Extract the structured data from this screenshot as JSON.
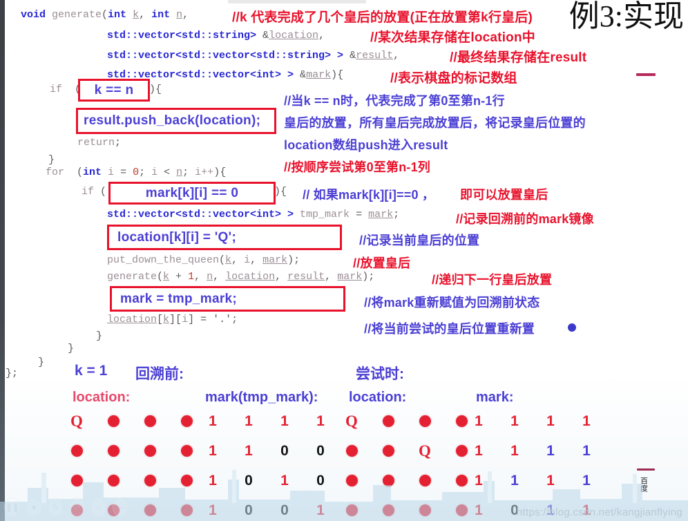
{
  "slide": {
    "title": "例3:实现",
    "watermark": "https://blog.csdn.net/kangjianflying",
    "side_note": "百度"
  },
  "code": {
    "lines": [
      {
        "id": "signature",
        "text": "void generate(int k, int n,"
      },
      {
        "id": "param-location",
        "text": "std::vector<std::string> &location,"
      },
      {
        "id": "param-result",
        "text": "std::vector<std::vector<std::string> > &result,"
      },
      {
        "id": "param-mark",
        "text": "std::vector<std::vector<int> > &mark){"
      },
      {
        "id": "if-open",
        "text": "if (        ){"
      },
      {
        "id": "return",
        "text": "return;"
      },
      {
        "id": "close-if",
        "text": "}"
      },
      {
        "id": "for-loop",
        "text": "for (int i = 0; i < n; i++){"
      },
      {
        "id": "if-mark",
        "text": "if (                    ){"
      },
      {
        "id": "tmp-mark",
        "text": "std::vector<std::vector<int> > tmp_mark = mark;"
      },
      {
        "id": "put-queen",
        "text": "put_down_the_queen(k, i, mark);"
      },
      {
        "id": "recurse",
        "text": "generate(k + 1, n, location, result, mark);"
      },
      {
        "id": "reset-location",
        "text": "location[k][i] = '.';"
      },
      {
        "id": "close-if2",
        "text": "}"
      },
      {
        "id": "close-for",
        "text": "}"
      },
      {
        "id": "close-fn",
        "text": "}"
      },
      {
        "id": "close-decl",
        "text": "};"
      }
    ],
    "highlight_boxes": [
      {
        "id": "box-k-eq-n",
        "text": "k == n"
      },
      {
        "id": "box-push-back",
        "text": "result.push_back(location);"
      },
      {
        "id": "box-mark-zero",
        "text": "mark[k][i] == 0"
      },
      {
        "id": "box-location-q",
        "text": "location[k][i] = 'Q';"
      },
      {
        "id": "box-mark-restore",
        "text": "mark = tmp_mark;"
      }
    ]
  },
  "annotations": [
    {
      "id": "ann-k-meaning",
      "text": "//k 代表完成了几个皇后的放置(正在放置第k行皇后)"
    },
    {
      "id": "ann-location",
      "text": "//某次结果存储在location中"
    },
    {
      "id": "ann-result",
      "text": "//最终结果存储在result"
    },
    {
      "id": "ann-mark",
      "text": "//表示棋盘的标记数组"
    },
    {
      "id": "ann-when-k-n",
      "text": "//当k == n时，代表完成了第0至第n-1行"
    },
    {
      "id": "ann-queen-place",
      "text": "皇后的放置，所有皇后完成放置后，将记录皇后位置的"
    },
    {
      "id": "ann-push-result",
      "text": "location数组push进入result"
    },
    {
      "id": "ann-try-cols",
      "text": "//按顺序尝试第0至第n-1列"
    },
    {
      "id": "ann-if-mark0-a",
      "text": "// 如果mark[k][i]==0 ，"
    },
    {
      "id": "ann-if-mark0-b",
      "text": "即可以放置皇后"
    },
    {
      "id": "ann-tmp-mark",
      "text": "//记录回溯前的mark镜像"
    },
    {
      "id": "ann-record-pos",
      "text": "//记录当前皇后的位置"
    },
    {
      "id": "ann-put-queen",
      "text": "//放置皇后"
    },
    {
      "id": "ann-recurse",
      "text": "//递归下一行皇后放置"
    },
    {
      "id": "ann-restore",
      "text": "//将mark重新赋值为回溯前状态"
    },
    {
      "id": "ann-reset",
      "text": "//将当前尝试的皇后位置重新置"
    }
  ],
  "diagram": {
    "k_label": "k = 1",
    "before_label": "回溯前:",
    "trying_label": "尝试时:",
    "panels": [
      {
        "id": "before-location",
        "label": "location:",
        "label_color": "red",
        "type": "board",
        "cells": [
          [
            "Q",
            ".",
            ".",
            "."
          ],
          [
            ".",
            ".",
            ".",
            "."
          ],
          [
            ".",
            ".",
            ".",
            "."
          ],
          [
            ".",
            ".",
            ".",
            "."
          ]
        ]
      },
      {
        "id": "before-mark",
        "label": "mark(tmp_mark):",
        "label_color": "purple",
        "type": "numbers",
        "values": [
          [
            "1",
            "1",
            "1",
            "1"
          ],
          [
            "1",
            "1",
            "0",
            "0"
          ],
          [
            "1",
            "0",
            "1",
            "0"
          ],
          [
            "1",
            "0",
            "0",
            "1"
          ]
        ],
        "colors": [
          [
            "red",
            "red",
            "red",
            "red"
          ],
          [
            "red",
            "red",
            "black",
            "black"
          ],
          [
            "red",
            "black",
            "red",
            "black"
          ],
          [
            "red",
            "black",
            "black",
            "red"
          ]
        ]
      },
      {
        "id": "trying-location",
        "label": "location:",
        "label_color": "purple",
        "type": "board",
        "cells": [
          [
            "Q",
            ".",
            ".",
            "."
          ],
          [
            ".",
            ".",
            "Q",
            "."
          ],
          [
            ".",
            ".",
            ".",
            "."
          ],
          [
            ".",
            ".",
            ".",
            "."
          ]
        ]
      },
      {
        "id": "trying-mark",
        "label": "mark:",
        "label_color": "purple",
        "type": "numbers",
        "values": [
          [
            "1",
            "1",
            "1",
            "1"
          ],
          [
            "1",
            "1",
            "1",
            "1"
          ],
          [
            "1",
            "1",
            "1",
            "1"
          ],
          [
            "1",
            "0",
            "1",
            "1"
          ]
        ],
        "colors": [
          [
            "red",
            "red",
            "red",
            "red"
          ],
          [
            "red",
            "red",
            "blue",
            "blue"
          ],
          [
            "red",
            "blue",
            "red",
            "blue"
          ],
          [
            "red",
            "black",
            "blue",
            "red"
          ]
        ]
      }
    ]
  },
  "player": {
    "buttons": [
      "pause-icon",
      "record-icon",
      "pen-icon",
      "refresh-icon",
      "search-icon",
      "minus-icon"
    ]
  },
  "colors": {
    "annotation_red": "#e8122c",
    "annotation_blue": "#4b3fd4",
    "box_border": "#e8122c",
    "dot_red": "#e42132"
  }
}
